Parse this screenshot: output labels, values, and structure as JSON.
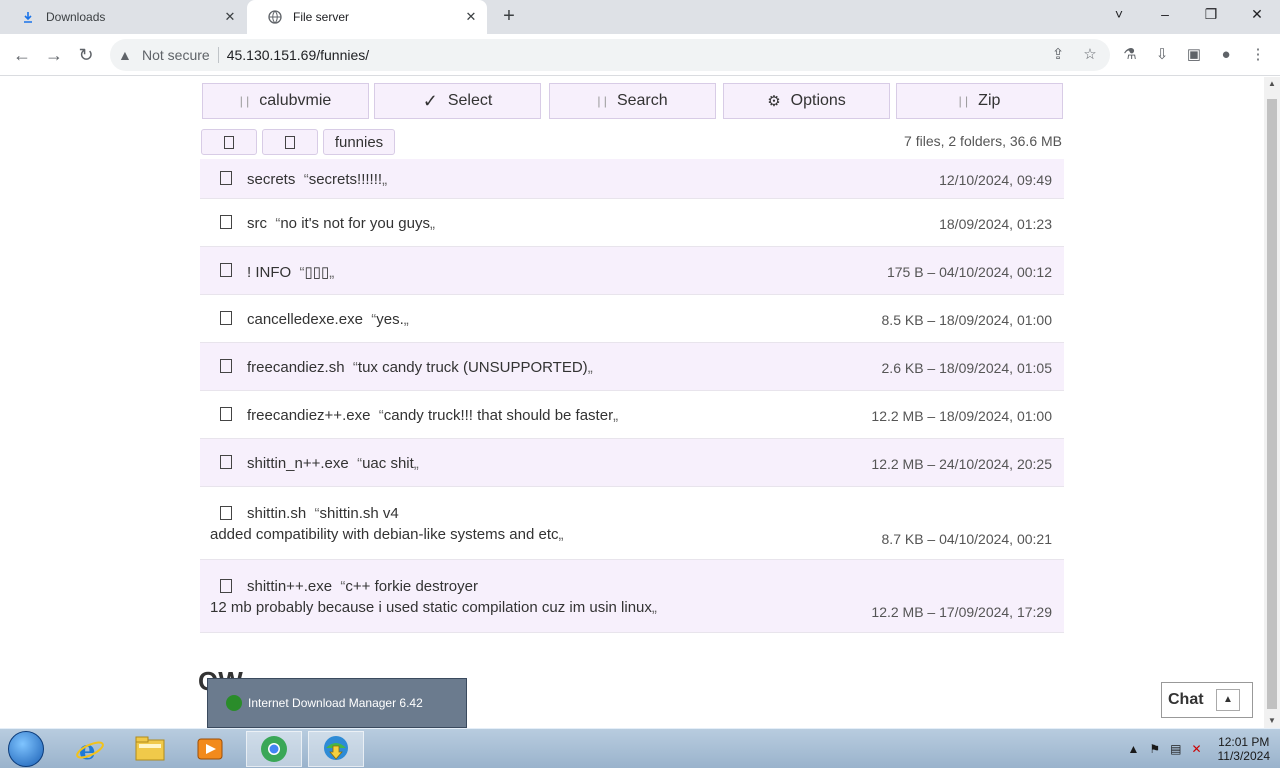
{
  "browser": {
    "tabs": [
      {
        "label": "Downloads",
        "icon": "download-icon"
      },
      {
        "label": "File server",
        "icon": "globe-icon"
      }
    ],
    "new_tab": "+",
    "window_controls": [
      "˅",
      "–",
      "❐",
      "✕"
    ],
    "security_label": "Not secure",
    "url": "45.130.151.69/funnies/"
  },
  "page": {
    "top_buttons": [
      {
        "label": "calubvmie",
        "glyph": "| |"
      },
      {
        "label": "Select",
        "glyph": "✓"
      },
      {
        "label": "Search",
        "glyph": "| |"
      },
      {
        "label": "Options",
        "glyph": "⚙"
      },
      {
        "label": "Zip",
        "glyph": "| |"
      }
    ],
    "breadcrumbs": [
      "",
      "",
      "funnies"
    ],
    "summary": "7 files, 2 folders, 36.6 MB",
    "files": [
      {
        "name": "secrets",
        "desc": "secrets!!!!!!",
        "desc2": "",
        "meta": "12/10/2024, 09:49"
      },
      {
        "name": "src",
        "desc": "no it's not for you guys",
        "desc2": "",
        "meta": "18/09/2024, 01:23"
      },
      {
        "name": "! INFO",
        "desc": "▯▯▯",
        "desc2": "",
        "meta": "175 B – 04/10/2024, 00:12"
      },
      {
        "name": "cancelledexe.exe",
        "desc": "yes.",
        "desc2": "",
        "meta": "8.5 KB – 18/09/2024, 01:00"
      },
      {
        "name": "freecandiez.sh",
        "desc": "tux candy truck (UNSUPPORTED)",
        "desc2": "",
        "meta": "2.6 KB – 18/09/2024, 01:05"
      },
      {
        "name": "freecandiez++.exe",
        "desc": "candy truck!!! that should be faster",
        "desc2": "",
        "meta": "12.2 MB – 18/09/2024, 01:00"
      },
      {
        "name": "shittin_n++.exe",
        "desc": "uac shit",
        "desc2": "",
        "meta": "12.2 MB – 24/10/2024, 20:25"
      },
      {
        "name": "shittin.sh",
        "desc": "shittin.sh v4",
        "desc2": "added compatibility with debian-like systems and etc",
        "meta": "8.7 KB – 04/10/2024, 00:21"
      },
      {
        "name": "shittin++.exe",
        "desc": "c++ forkie destroyer",
        "desc2": "12 mb probably because i used static compilation cuz im usin linux",
        "meta": "12.2 MB – 17/09/2024, 17:29"
      }
    ],
    "open_quote": "“",
    "close_quote": "„",
    "partial_heading": "OW",
    "chat_label": "Chat",
    "chat_up": "▲"
  },
  "idm_popup": {
    "label": "Internet Download Manager 6.42"
  },
  "taskbar": {
    "items": [
      "internet-explorer",
      "file-explorer",
      "media-player",
      "chrome",
      "idm"
    ],
    "clock_time": "12:01 PM",
    "clock_date": "11/3/2024"
  }
}
